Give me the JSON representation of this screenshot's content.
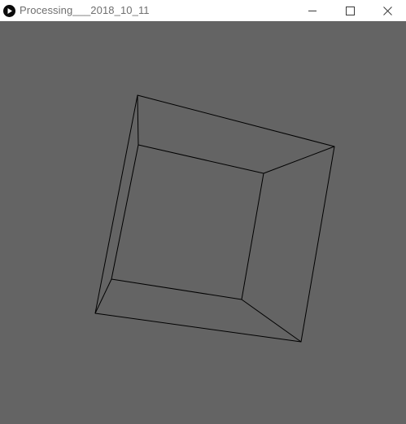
{
  "window": {
    "title": "Processing___2018_10_11",
    "icons": {
      "app": "processing-play-icon",
      "minimize": "minimize-icon",
      "maximize": "maximize-icon",
      "close": "close-icon"
    }
  },
  "colors": {
    "canvas_background": "#646464",
    "stroke": "#000000",
    "titlebar_background": "#ffffff",
    "title_text": "#6f6f6f"
  }
}
